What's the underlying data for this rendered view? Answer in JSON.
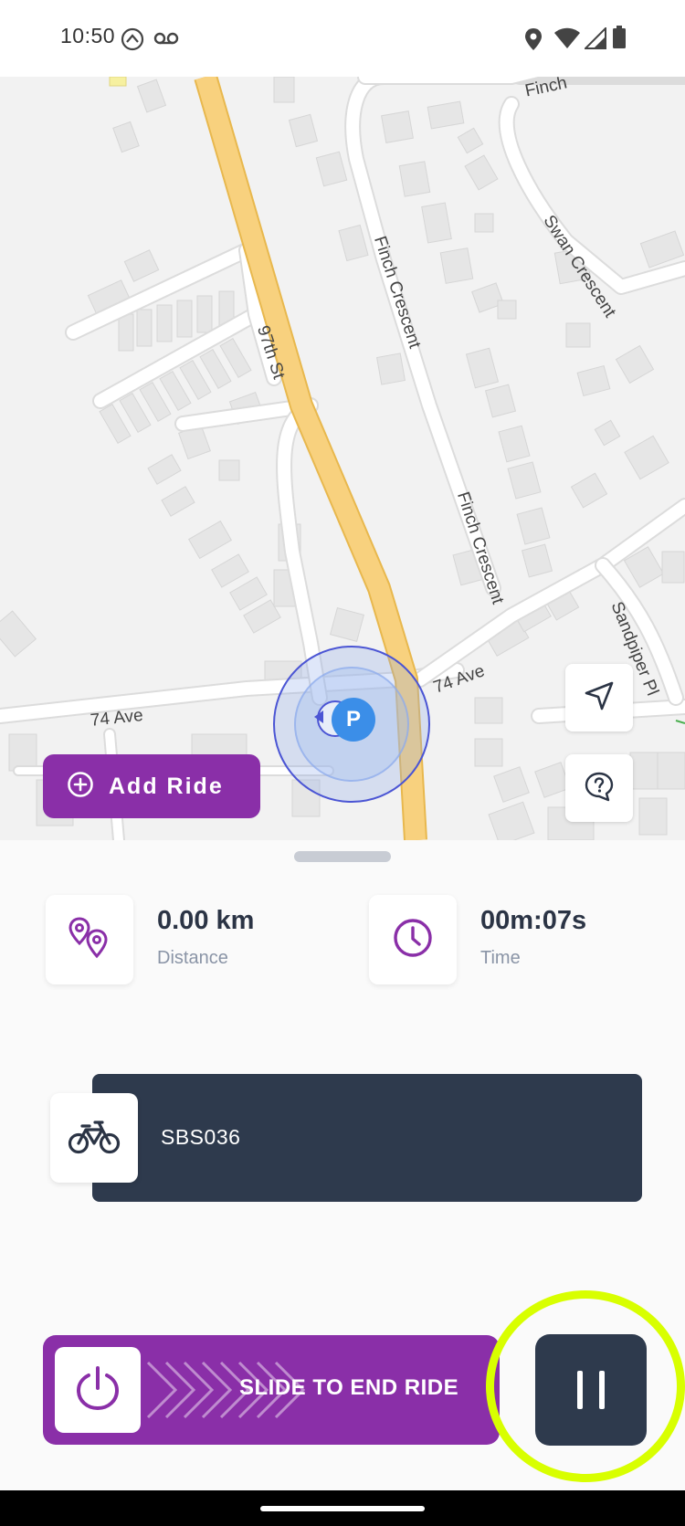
{
  "status_bar": {
    "time": "10:50",
    "icons": [
      "app-notification-icon",
      "voicemail-icon",
      "location-icon",
      "wifi-icon",
      "cellular-signal-icon",
      "battery-icon"
    ]
  },
  "map": {
    "street_labels": {
      "finch_top": "Finch",
      "finch_crescent_1": "Finch Crescent",
      "finch_crescent_2": "Finch Crescent",
      "swan_crescent": "Swan Crescent",
      "ninety_seventh_st": "97th St",
      "ave_74_left": "74 Ave",
      "ave_74_right": "74 Ave",
      "sandpiper_pl": "Sandpiper Pl"
    },
    "marker_letter": "P",
    "buttons": [
      "navigate-icon",
      "help-icon"
    ],
    "add_ride_label": "Add Ride",
    "colors": {
      "road_major": "#f8d17e",
      "location_ring": "#4b55d4",
      "marker": "#3b8ee8"
    }
  },
  "ride_stats": {
    "distance": {
      "value": "0.00 km",
      "label": "Distance"
    },
    "time": {
      "value": "00m:07s",
      "label": "Time"
    }
  },
  "bike": {
    "id": "SBS036"
  },
  "controls": {
    "slide_label": "SLIDE TO END RIDE",
    "accent": "#8a2fa8",
    "dark": "#2e3a4d",
    "highlight": "#d8ff00"
  }
}
